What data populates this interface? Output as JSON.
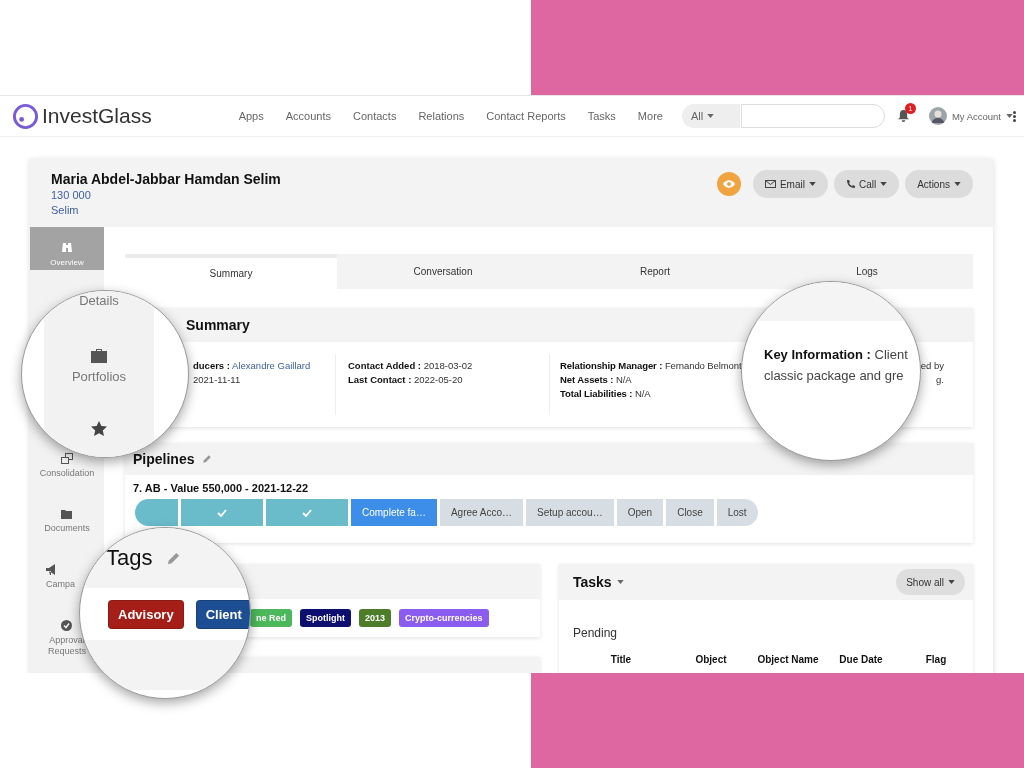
{
  "navbar": {
    "logo": "InvestGlass",
    "menu": [
      "Apps",
      "Accounts",
      "Contacts",
      "Relations",
      "Contact Reports",
      "Tasks",
      "More"
    ],
    "search_scope": "All",
    "notification_count": "1",
    "account": "My Account"
  },
  "contact": {
    "name": "Maria Abdel-Jabbar Hamdan Selim",
    "amount": "130 000",
    "short_name": "Selim",
    "actions": [
      "Email",
      "Call",
      "Actions"
    ]
  },
  "sidebar": {
    "items": [
      {
        "label": "Overview",
        "kind": "overview",
        "selected": true
      },
      {
        "label": "Consolidation",
        "kind": "consolidation",
        "selected": false
      },
      {
        "label": "Documents",
        "kind": "documents",
        "selected": false
      },
      {
        "label": "Campa",
        "kind": "campaigns",
        "selected": false
      },
      {
        "label": "Approval Requests",
        "kind": "approval",
        "selected": false
      }
    ]
  },
  "tabs": [
    {
      "label": "Summary",
      "selected": true
    },
    {
      "label": "Conversation",
      "selected": false
    },
    {
      "label": "Report",
      "selected": false
    },
    {
      "label": "Logs",
      "selected": false
    }
  ],
  "summary": {
    "title": "Summary",
    "columns": [
      [
        {
          "label": "ducers :",
          "value": "Alexandre Gaillard",
          "kind": "link"
        },
        {
          "value": "2021-11-11",
          "kind": "text"
        }
      ],
      [
        {
          "label": "Contact Added :",
          "value": "2018-03-02",
          "kind": "text"
        },
        {
          "label": "Last Contact :",
          "value": "2022-05-20",
          "kind": "text"
        }
      ],
      [
        {
          "label": "Relationship Manager :",
          "value": "Fernando Belmont",
          "kind": "text"
        },
        {
          "label": "Net Assets :",
          "value": "N/A",
          "kind": "text"
        },
        {
          "label": "Total Liabilities :",
          "value": "N/A",
          "kind": "text"
        }
      ],
      [
        {
          "value": "ed by",
          "kind": "text"
        },
        {
          "value": "g.",
          "kind": "text"
        }
      ]
    ]
  },
  "pipeline": {
    "title": "Pipelines",
    "deal": "7. AB - Value 550,000 - 2021-12-22",
    "stages": [
      {
        "kind": "done"
      },
      {
        "kind": "done"
      },
      {
        "kind": "done"
      },
      {
        "label": "Complete fa…",
        "kind": "current"
      },
      {
        "label": "Agree Acco…",
        "kind": "pending"
      },
      {
        "label": "Setup accou…",
        "kind": "pending"
      },
      {
        "label": "Open",
        "kind": "pending"
      },
      {
        "label": "Close",
        "kind": "pending"
      },
      {
        "label": "Lost",
        "kind": "pending"
      }
    ]
  },
  "tags": [
    {
      "label": "ne Red",
      "color": "#4cb85c"
    },
    {
      "label": "Spotlight",
      "color": "#0d1070"
    },
    {
      "label": "2013",
      "color": "#4e7d2a"
    },
    {
      "label": "Crypto-currencies",
      "color": "#8a5cf0"
    }
  ],
  "tasks": {
    "title": "Tasks",
    "filter": "Show all",
    "section": "Pending",
    "columns": [
      "Title",
      "Object",
      "Object Name",
      "Due Date",
      "Flag"
    ]
  },
  "magnifiers": [
    {
      "kind": "sidebar",
      "labels": [
        "Details",
        "Portfolios"
      ]
    },
    {
      "kind": "info",
      "label": "Key Information :",
      "value": "Client",
      "continuation": "classic package and gre"
    },
    {
      "kind": "tags",
      "title": "Tags",
      "tags": [
        {
          "label": "Advisory",
          "color": "#a61e18"
        },
        {
          "label": "Client",
          "color": "#1d4d92"
        }
      ]
    }
  ]
}
